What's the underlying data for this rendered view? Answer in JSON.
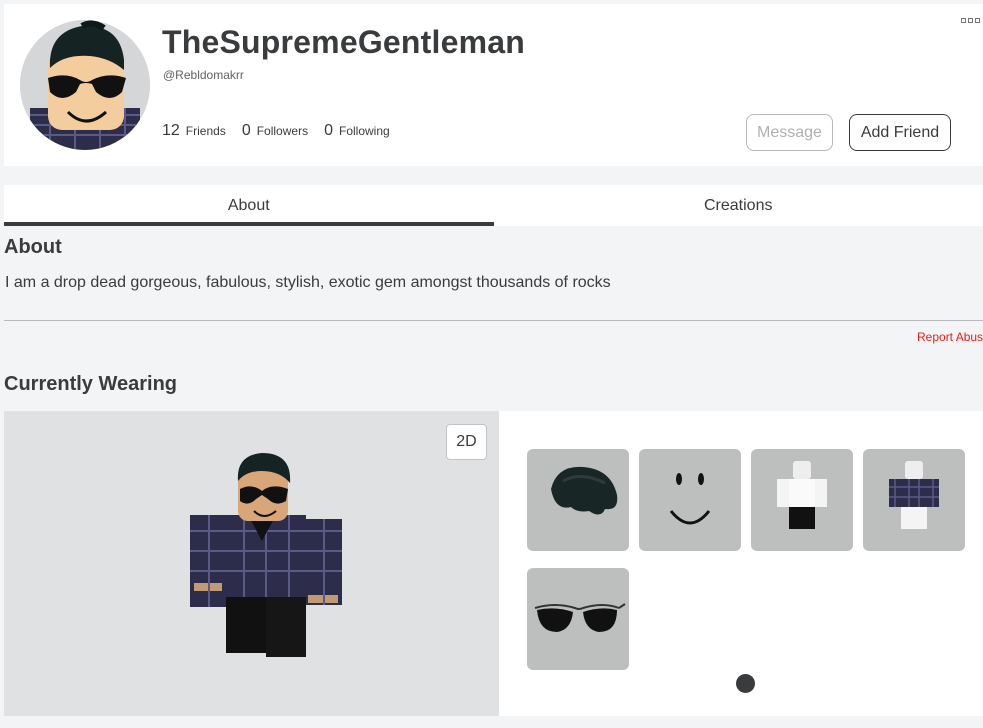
{
  "profile": {
    "display_name": "TheSupremeGentleman",
    "username": "@Rebldomakrr",
    "stats": [
      {
        "count": "12",
        "label": "Friends"
      },
      {
        "count": "0",
        "label": "Followers"
      },
      {
        "count": "0",
        "label": "Following"
      }
    ],
    "buttons": {
      "message": "Message",
      "add_friend": "Add Friend"
    }
  },
  "tabs": [
    {
      "label": "About",
      "active": true
    },
    {
      "label": "Creations",
      "active": false
    }
  ],
  "about": {
    "title": "About",
    "text": "I am a drop dead gorgeous, fabulous, stylish, exotic gem amongst thousands of rocks",
    "report_label": "Report Abuse"
  },
  "wearing": {
    "title": "Currently Wearing",
    "toggle_label": "2D",
    "items": [
      {
        "icon": "hair-icon"
      },
      {
        "icon": "smile-face-icon"
      },
      {
        "icon": "white-shirt-icon"
      },
      {
        "icon": "plaid-shirt-icon"
      },
      {
        "icon": "aviator-sunglasses-icon"
      }
    ]
  },
  "colors": {
    "accent": "#393b3d",
    "report": "#e2231a",
    "plaid": "#2d2c4a"
  }
}
